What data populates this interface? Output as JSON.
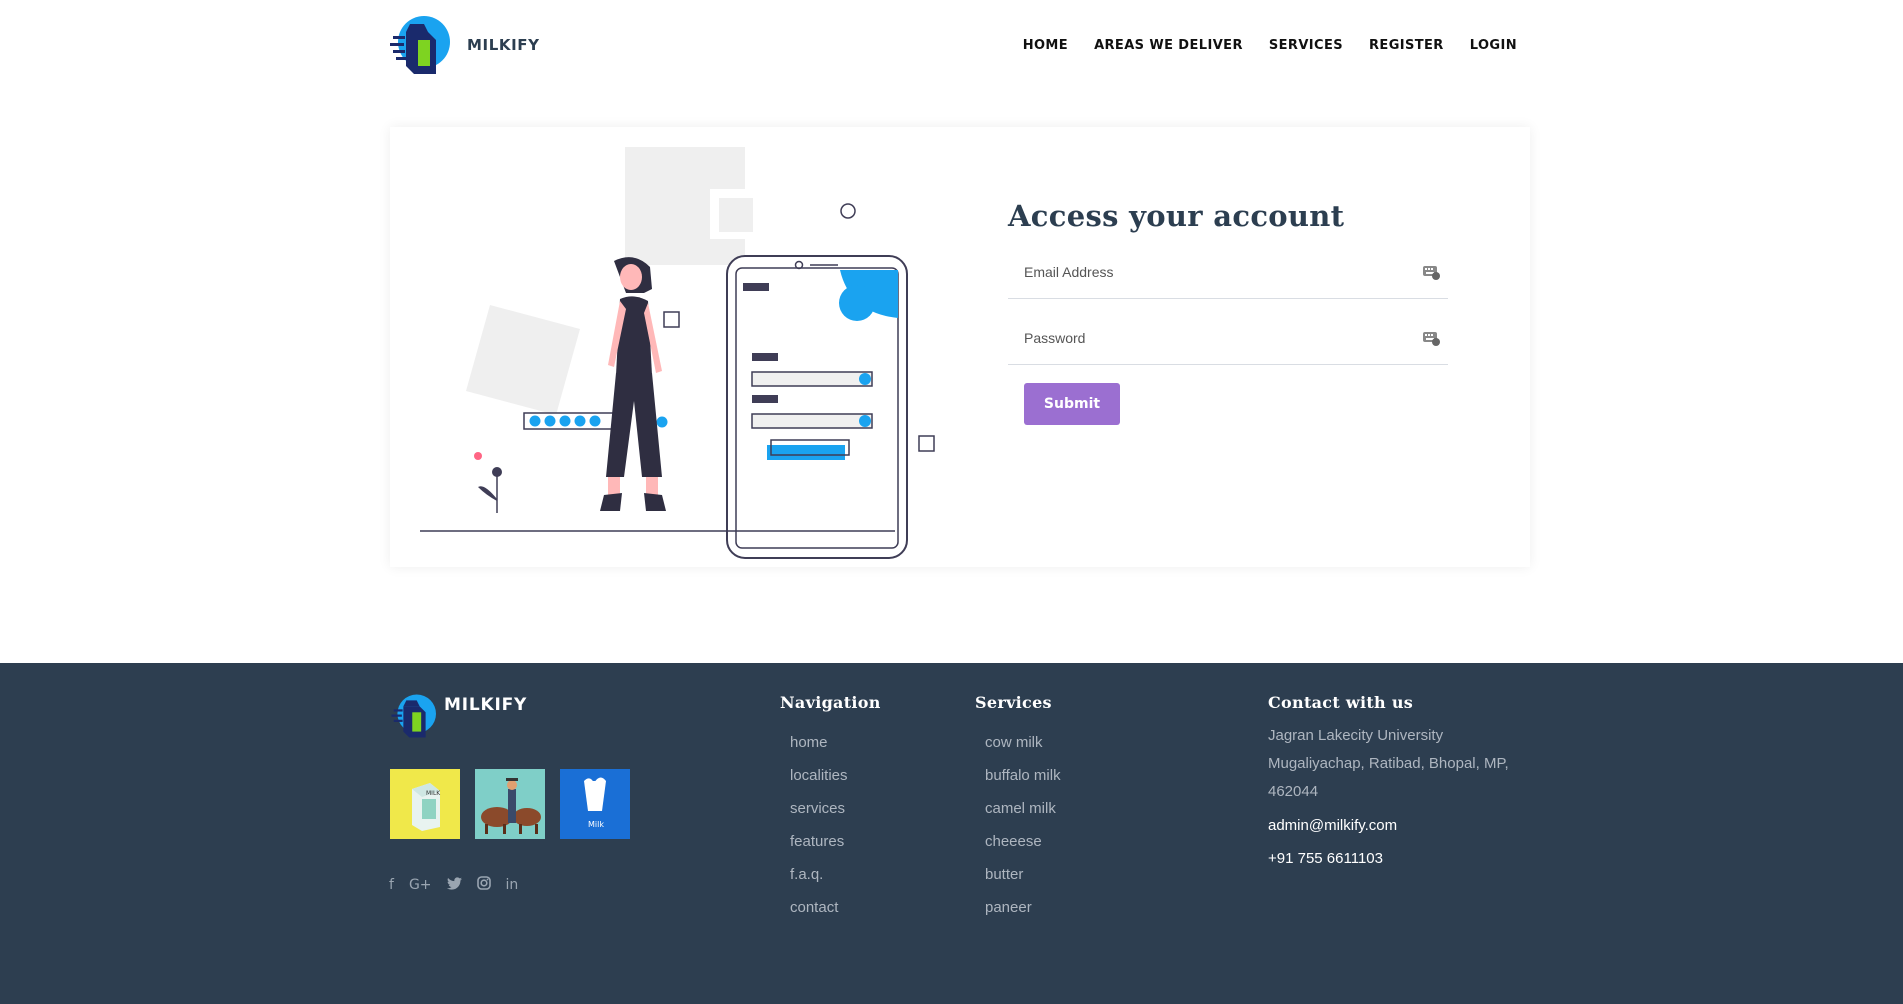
{
  "brand": {
    "name": "MILKIFY"
  },
  "nav": {
    "items": [
      "HOME",
      "AREAS WE DELIVER",
      "SERVICES",
      "REGISTER",
      "LOGIN"
    ]
  },
  "login": {
    "title": "Access your account",
    "email_placeholder": "Email Address",
    "password_placeholder": "Password",
    "submit_label": "Submit"
  },
  "footer": {
    "brand_name": "MILKIFY",
    "navigation": {
      "title": "Navigation",
      "items": [
        "home",
        "localities",
        "services",
        "features",
        "f.a.q.",
        "contact"
      ]
    },
    "services": {
      "title": "Services",
      "items": [
        "cow milk",
        "buffalo milk",
        "camel milk",
        "cheeese",
        "butter",
        "paneer"
      ]
    },
    "contact": {
      "title": "Contact with us",
      "address_lines": [
        "Jagran Lakecity University",
        "Mugaliyachap, Ratibad, Bhopal, MP,",
        "462044"
      ],
      "email": "admin@milkify.com",
      "phone": "+91 755 6611103"
    },
    "thumbnails": [
      "milk-carton-image",
      "farmer-cow-image",
      "milk-glass-image"
    ],
    "social_icons": [
      "facebook-icon",
      "google-plus-icon",
      "twitter-icon",
      "instagram-icon",
      "linkedin-icon"
    ]
  },
  "colors": {
    "accent_purple": "#9b6fd1",
    "footer_bg": "#2d3e50",
    "blue": "#1aa3f0",
    "green": "#7ed321"
  }
}
